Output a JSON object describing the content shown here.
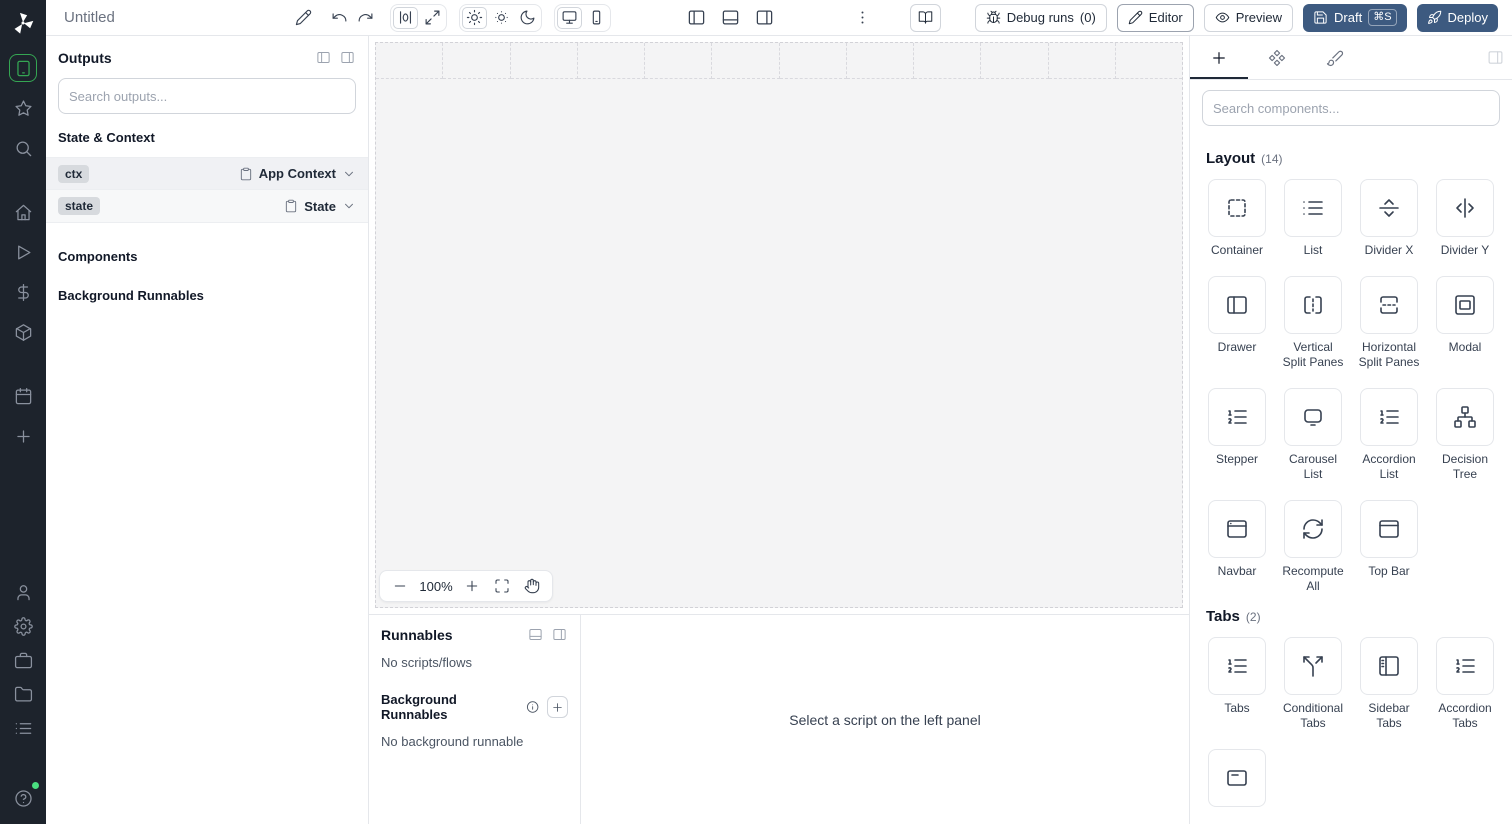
{
  "colors": {
    "sidebar_bg": "#1d232c",
    "accent_green": "#35a653",
    "primary_button_blue": "#3d5a80"
  },
  "topbar": {
    "title": "Untitled",
    "debug_runs_label": "Debug runs",
    "debug_runs_count": "(0)",
    "editor_label": "Editor",
    "preview_label": "Preview",
    "draft_label": "Draft",
    "draft_shortcut": "⌘S",
    "deploy_label": "Deploy"
  },
  "outputs_panel": {
    "title": "Outputs",
    "search_placeholder": "Search outputs...",
    "sections": {
      "state_context": "State & Context",
      "components": "Components",
      "background_runnables": "Background Runnables"
    },
    "rows": [
      {
        "key": "ctx",
        "type": "App Context"
      },
      {
        "key": "state",
        "type": "State"
      }
    ]
  },
  "canvas": {
    "zoom_level": "100%"
  },
  "runnables_panel": {
    "title": "Runnables",
    "empty_text": "No scripts/flows",
    "background_title": "Background Runnables",
    "background_empty_text": "No background runnable"
  },
  "script_panel": {
    "hint": "Select a script on the left panel"
  },
  "components_panel": {
    "search_placeholder": "Search components...",
    "sections": [
      {
        "title": "Layout",
        "count": "(14)",
        "items": [
          {
            "label": "Container",
            "icon": "container"
          },
          {
            "label": "List",
            "icon": "list"
          },
          {
            "label": "Divider X",
            "icon": "divider-x"
          },
          {
            "label": "Divider Y",
            "icon": "divider-y"
          },
          {
            "label": "Drawer",
            "icon": "drawer"
          },
          {
            "label": "Vertical Split Panes",
            "icon": "vertical-split"
          },
          {
            "label": "Horizontal Split Panes",
            "icon": "horizontal-split"
          },
          {
            "label": "Modal",
            "icon": "modal"
          },
          {
            "label": "Stepper",
            "icon": "stepper"
          },
          {
            "label": "Carousel List",
            "icon": "carousel"
          },
          {
            "label": "Accordion List",
            "icon": "accordion-list"
          },
          {
            "label": "Decision Tree",
            "icon": "decision-tree"
          },
          {
            "label": "Navbar",
            "icon": "navbar"
          },
          {
            "label": "Recompute All",
            "icon": "recompute"
          },
          {
            "label": "Top Bar",
            "icon": "top-bar"
          }
        ]
      },
      {
        "title": "Tabs",
        "count": "(2)",
        "items": [
          {
            "label": "Tabs",
            "icon": "tabs"
          },
          {
            "label": "Conditional Tabs",
            "icon": "conditional-tabs"
          },
          {
            "label": "Sidebar Tabs",
            "icon": "sidebar-tabs"
          },
          {
            "label": "Accordion Tabs",
            "icon": "accordion-tabs"
          },
          {
            "label": "",
            "icon": "invisible-tabs",
            "partial": true
          }
        ]
      }
    ]
  }
}
